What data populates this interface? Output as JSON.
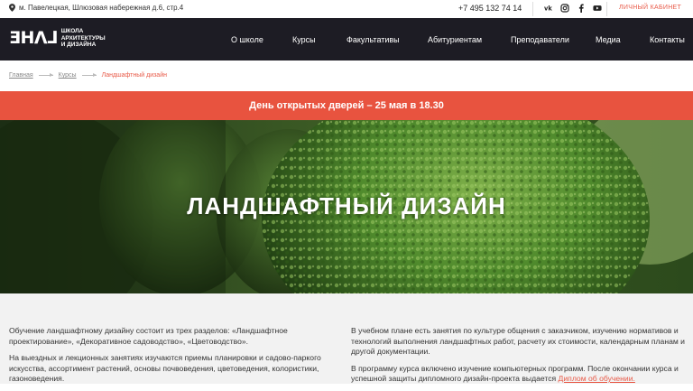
{
  "topbar": {
    "address": "м. Павелецкая, Шлюзовая набережная д.6, стр.4",
    "phone": "+7 495 132 74 14",
    "socials": [
      "vk-icon",
      "instagram-icon",
      "facebook-icon",
      "youtube-icon"
    ],
    "cabinet": "ЛИЧНЫЙ КАБИНЕТ"
  },
  "logo": {
    "mark": "ƎHΛ⅃",
    "line1": "школа",
    "line2": "архитектуры",
    "line3": "и дизайна"
  },
  "nav": [
    "О школе",
    "Курсы",
    "Факультативы",
    "Абитуриентам",
    "Преподаватели",
    "Медиа",
    "Контакты"
  ],
  "breadcrumb": {
    "home": "Главная",
    "courses": "Курсы",
    "current": "Ландшафтный дизайн"
  },
  "banner": "День открытых дверей – 25 мая в 18.30",
  "hero": {
    "title": "ЛАНДШАФТНЫЙ ДИЗАЙН"
  },
  "content": {
    "left_p1": "Обучение ландшафтному дизайну состоит из трех разделов: «Ландшафтное проектирование», «Декоративное садоводство», «Цветоводство».",
    "left_p2": "На выездных и лекционных занятиях  изучаются приемы планировки и садово-паркого искусства, ассортимент растений, основы почвоведения, цветоведения, колористики, газоноведения.",
    "right_p1": "В учебном плане есть занятия по культуре общения с заказчиком, изучению нормативов и технологий выполнения ландшафтных работ, расчету их стоимости, календарным планам и другой документации.",
    "right_p2": "В программу курса включено изучение компьютерных программ. После окончании курса и успешной защиты дипломного дизайн-проекта выдается ",
    "right_p2_link": "Диплом об обучении."
  },
  "colors": {
    "accent": "#e8533f",
    "nav_bg": "#1d1c24",
    "content_bg": "#f2f2f2"
  }
}
